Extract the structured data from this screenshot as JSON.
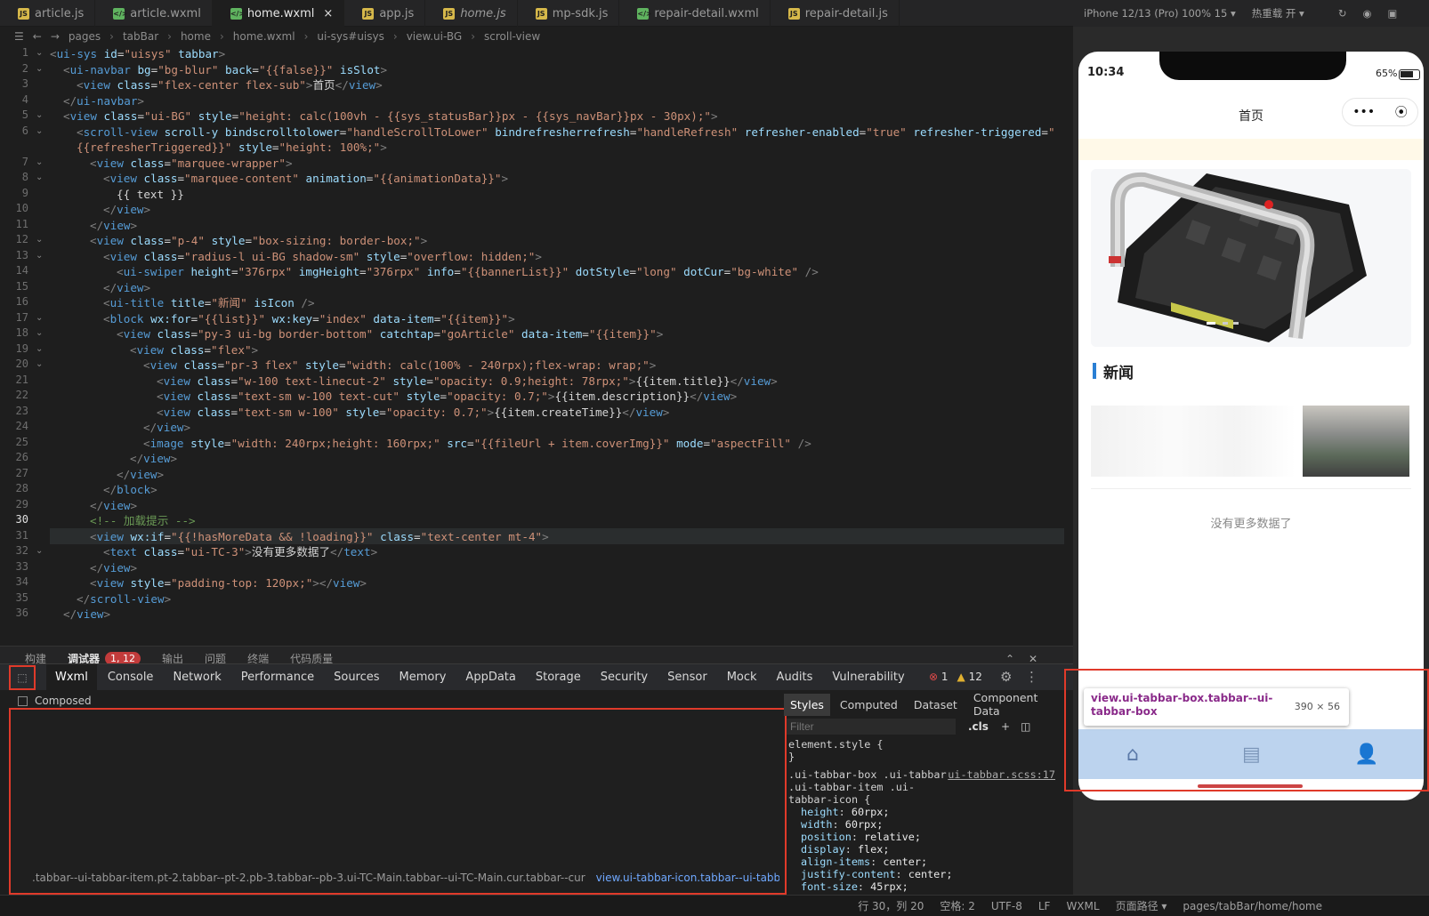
{
  "editor_tabs": [
    {
      "label": "article.js",
      "type": "js"
    },
    {
      "label": "article.wxml",
      "type": "wxml"
    },
    {
      "label": "home.wxml",
      "type": "wxml",
      "active": true
    },
    {
      "label": "app.js",
      "type": "js"
    },
    {
      "label": "home.js",
      "type": "js",
      "italic": true
    },
    {
      "label": "mp-sdk.js",
      "type": "js"
    },
    {
      "label": "repair-detail.wxml",
      "type": "wxml"
    },
    {
      "label": "repair-detail.js",
      "type": "js"
    }
  ],
  "tab_close": "×",
  "breadcrumb": [
    "pages",
    "tabBar",
    "home",
    "home.wxml",
    "ui-sys#uisys",
    "view.ui-BG",
    "scroll-view"
  ],
  "simulator": {
    "device": "iPhone 12/13 (Pro) 100% 15 ▾",
    "hot_reload": "热重载 开 ▾"
  },
  "code_lines": [
    "1",
    "2",
    "3",
    "4",
    "5",
    "6",
    "",
    "7",
    "8",
    "9",
    "10",
    "11",
    "12",
    "13",
    "14",
    "15",
    "16",
    "17",
    "18",
    "19",
    "20",
    "21",
    "22",
    "23",
    "24",
    "25",
    "26",
    "27",
    "28",
    "29",
    "30",
    "31",
    "32",
    "33",
    "34",
    "35",
    "36"
  ],
  "panel_tabs": [
    "构建",
    "调试器",
    "输出",
    "问题",
    "终端",
    "代码质量"
  ],
  "panel_badge": "1, 12",
  "devtools_tabs": [
    "Wxml",
    "Console",
    "Network",
    "Performance",
    "Sources",
    "Memory",
    "AppData",
    "Storage",
    "Security",
    "Sensor",
    "Mock",
    "Audits",
    "Vulnerability"
  ],
  "devtools_counts": {
    "errors": "1",
    "warnings": "12"
  },
  "composed_label": "Composed",
  "wxml_path": {
    "main": ".tabbar--ui-tabbar-item.pt-2.tabbar--pt-2.pb-3.tabbar--pb-3.ui-TC-Main.tabbar--ui-TC-Main.cur.tabbar--cur",
    "selected": "view.ui-tabbar-icon.tabbar--ui-tabbar-icon",
    "more": "…"
  },
  "styles_tabs": [
    "Styles",
    "Computed",
    "Dataset",
    "Component Data"
  ],
  "filter_placeholder": "Filter",
  "cls_label": ".cls",
  "styles": {
    "element_style": "element.style {",
    "close": "}",
    "selector1": ".ui-tabbar-box .ui-tabbar",
    "selector2": ".ui-tabbar-item .ui-",
    "selector3": "tabbar-icon {",
    "source": "ui-tabbar.scss:17",
    "props": [
      [
        "height",
        "60rpx;"
      ],
      [
        "width",
        "60rpx;"
      ],
      [
        "position",
        "relative;"
      ],
      [
        "display",
        "flex;"
      ],
      [
        "align-items",
        "center;"
      ],
      [
        "justify-content",
        "center;"
      ],
      [
        "font-size",
        "45rpx;"
      ]
    ]
  },
  "status": [
    "行 30，列 20",
    "空格: 2",
    "UTF-8",
    "LF",
    "WXML",
    "页面路径 ▾",
    "pages/tabBar/home/home"
  ],
  "phone": {
    "time": "10:34",
    "battery": "65%",
    "title": "首页",
    "capsule_more": "•••",
    "capsule_close": "⦿",
    "news_title": "新闻",
    "no_more": "没有更多数据了"
  },
  "tooltip": {
    "selector": "view.ui-tabbar-box.tabbar--ui-tabbar-box",
    "size": "390 × 56"
  },
  "colors": {
    "highlight": "#e03a2a",
    "tabbar": "#bcd3ee",
    "accent": "#2a7fd4"
  }
}
